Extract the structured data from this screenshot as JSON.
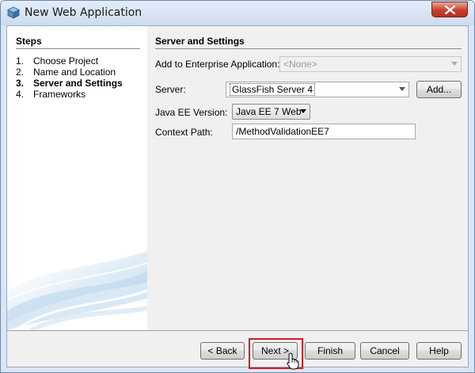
{
  "window": {
    "title": "New Web Application",
    "title_icon": "cube-icon",
    "close_icon": "close-icon"
  },
  "steps": {
    "heading": "Steps",
    "items": [
      {
        "num": "1.",
        "label": "Choose Project"
      },
      {
        "num": "2.",
        "label": "Name and Location"
      },
      {
        "num": "3.",
        "label": "Server and Settings",
        "current": true
      },
      {
        "num": "4.",
        "label": "Frameworks"
      }
    ]
  },
  "settings": {
    "heading": "Server and Settings",
    "enterprise_label": "Add to Enterprise Application:",
    "enterprise_value": "<None>",
    "server_label": "Server:",
    "server_value": "GlassFish Server 4",
    "add_button": "Add...",
    "javaee_label": "Java EE Version:",
    "javaee_value": "Java EE 7 Web",
    "context_label": "Context Path:",
    "context_value": "/MethodValidationEE7"
  },
  "buttons": {
    "back": "< Back",
    "next": "Next >",
    "finish": "Finish",
    "cancel": "Cancel",
    "help": "Help"
  },
  "colors": {
    "highlight": "#d21f1f",
    "title_bar": "#cddcef"
  }
}
